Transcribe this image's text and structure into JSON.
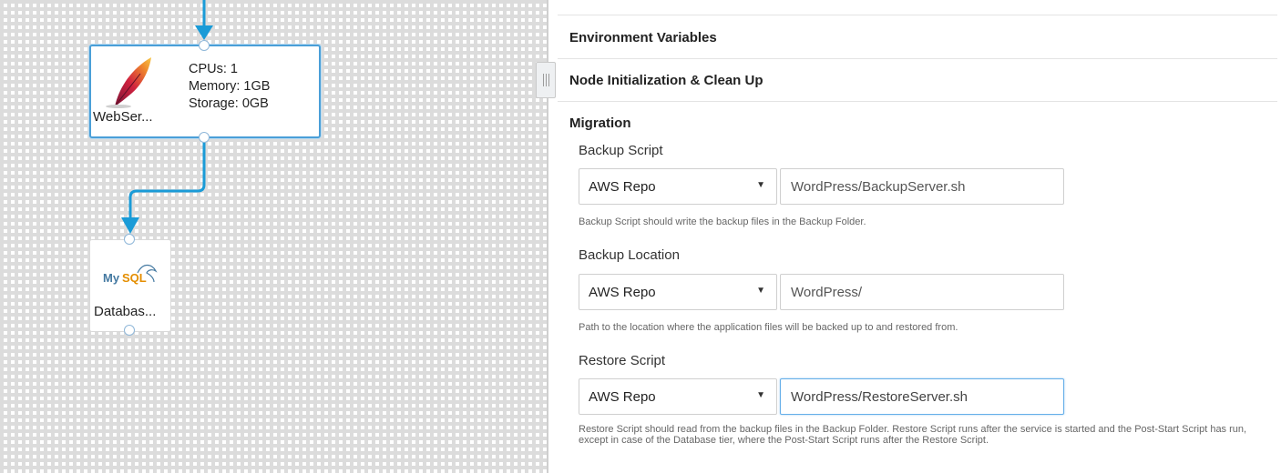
{
  "canvas": {
    "webserver_node": {
      "name": "WebSer...",
      "specs": [
        "CPUs: 1",
        "Memory: 1GB",
        "Storage: 0GB"
      ],
      "icon": "feather-icon"
    },
    "database_node": {
      "name": "Databas...",
      "icon": "mysql-icon",
      "logo_text": "MySQL"
    },
    "accent_color": "#1a9bd7"
  },
  "splitter": {
    "icon": "grip-icon"
  },
  "panel": {
    "sections": {
      "environment_variables": "Environment Variables",
      "node_init": "Node Initialization & Clean Up",
      "migration": "Migration"
    },
    "backup_script": {
      "label": "Backup Script",
      "repo": "AWS Repo",
      "value": "WordPress/BackupServer.sh",
      "help": "Backup Script should write the backup files in the Backup Folder."
    },
    "backup_location": {
      "label": "Backup Location",
      "repo": "AWS Repo",
      "value": "WordPress/",
      "help": "Path to the location where the application files will be backed up to and restored from."
    },
    "restore_script": {
      "label": "Restore Script",
      "repo": "AWS Repo",
      "value": "WordPress/RestoreServer.sh",
      "help": "Restore Script should read from the backup files in the Backup Folder. Restore Script runs after the service is started and the Post-Start Script has run, except in case of the Database tier, where the Post-Start Script runs after the Restore Script."
    }
  }
}
